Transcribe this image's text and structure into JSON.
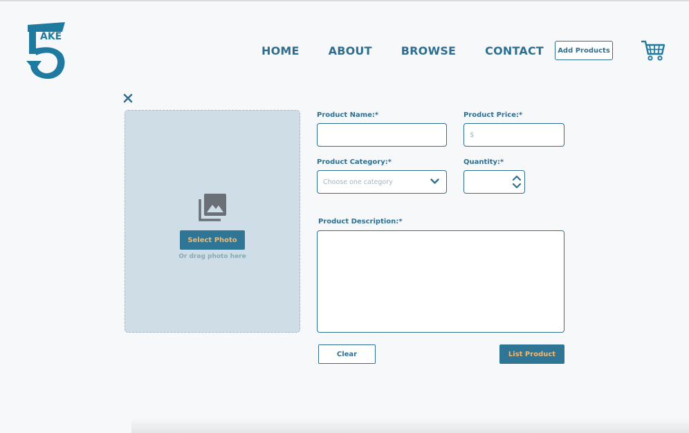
{
  "brand": {
    "logo_text": "AKE",
    "logo_digit": "5"
  },
  "nav": {
    "home": "HOME",
    "about": "ABOUT",
    "browse": "BROWSE",
    "contact": "CONTACT",
    "add_products": "Add Products"
  },
  "upload": {
    "select_label": "Select Photo",
    "drag_text": "Or drag photo here"
  },
  "form": {
    "name_label": "Product Name:*",
    "name_value": "",
    "price_label": "Product Price:*",
    "price_placeholder": "$",
    "category_label": "Product Category:*",
    "category_selected": "Choose one category",
    "quantity_label": "Quantity:*",
    "quantity_value": "",
    "description_label": "Product Description:*",
    "description_value": ""
  },
  "actions": {
    "clear": "Clear",
    "list": "List Product"
  },
  "colors": {
    "primary": "#2e6f91",
    "button_bg": "#2f7595",
    "button_text": "#f1b872",
    "dropzone_bg": "#cedde6"
  },
  "icons": [
    "logo-icon",
    "cart-icon",
    "close-icon",
    "photo-library-icon",
    "chevron-down-icon",
    "stepper-icon"
  ]
}
